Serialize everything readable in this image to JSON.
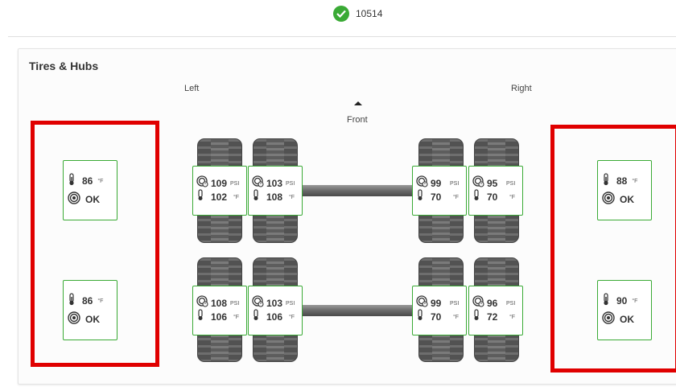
{
  "header": {
    "vehicle_id": "10514",
    "status_icon": "check-circle-icon",
    "status_color": "#3aaa35"
  },
  "section": {
    "title": "Tires & Hubs",
    "left_label": "Left",
    "right_label": "Right",
    "front_label": "Front",
    "accent_color": "#3aaa35",
    "highlight_color": "#e00000"
  },
  "hubs": {
    "left_front": {
      "temp": "86",
      "temp_unit": "°F",
      "status": "OK"
    },
    "left_rear": {
      "temp": "86",
      "temp_unit": "°F",
      "status": "OK"
    },
    "right_front": {
      "temp": "88",
      "temp_unit": "°F",
      "status": "OK"
    },
    "right_rear": {
      "temp": "90",
      "temp_unit": "°F",
      "status": "OK"
    }
  },
  "tires": {
    "front_left_outer": {
      "pressure": "109",
      "pressure_unit": "PSI",
      "temp": "102",
      "temp_unit": "°F"
    },
    "front_left_inner": {
      "pressure": "103",
      "pressure_unit": "PSI",
      "temp": "108",
      "temp_unit": "°F"
    },
    "front_right_inner": {
      "pressure": "99",
      "pressure_unit": "PSI",
      "temp": "70",
      "temp_unit": "°F"
    },
    "front_right_outer": {
      "pressure": "95",
      "pressure_unit": "PSI",
      "temp": "70",
      "temp_unit": "°F"
    },
    "rear_left_outer": {
      "pressure": "108",
      "pressure_unit": "PSI",
      "temp": "106",
      "temp_unit": "°F"
    },
    "rear_left_inner": {
      "pressure": "103",
      "pressure_unit": "PSI",
      "temp": "106",
      "temp_unit": "°F"
    },
    "rear_right_inner": {
      "pressure": "99",
      "pressure_unit": "PSI",
      "temp": "70",
      "temp_unit": "°F"
    },
    "rear_right_outer": {
      "pressure": "96",
      "pressure_unit": "PSI",
      "temp": "72",
      "temp_unit": "°F"
    }
  }
}
